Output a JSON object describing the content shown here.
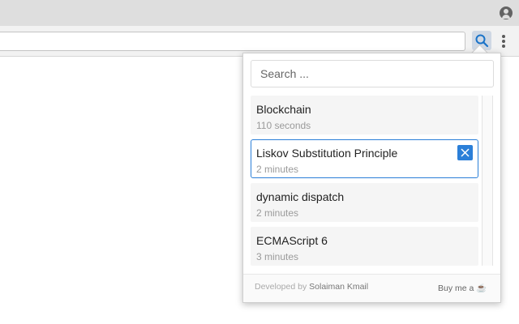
{
  "browser": {
    "profile_icon": "account-circle-icon",
    "extension_icon": "search-icon",
    "menu_icon": "vertical-dots-icon"
  },
  "popup": {
    "search_placeholder": "Search ...",
    "items": [
      {
        "title": "Blockchain",
        "time": "110 seconds"
      },
      {
        "title": "Liskov Substitution Principle",
        "time": "2 minutes"
      },
      {
        "title": "dynamic dispatch",
        "time": "2 minutes"
      },
      {
        "title": "ECMAScript 6",
        "time": "3 minutes"
      }
    ],
    "footer": {
      "developed_by": "Developed by",
      "author": "Solaiman Kmail",
      "buy": "Buy me a ☕"
    }
  },
  "colors": {
    "accent": "#2b7fd8",
    "item_bg": "#f5f5f5"
  }
}
